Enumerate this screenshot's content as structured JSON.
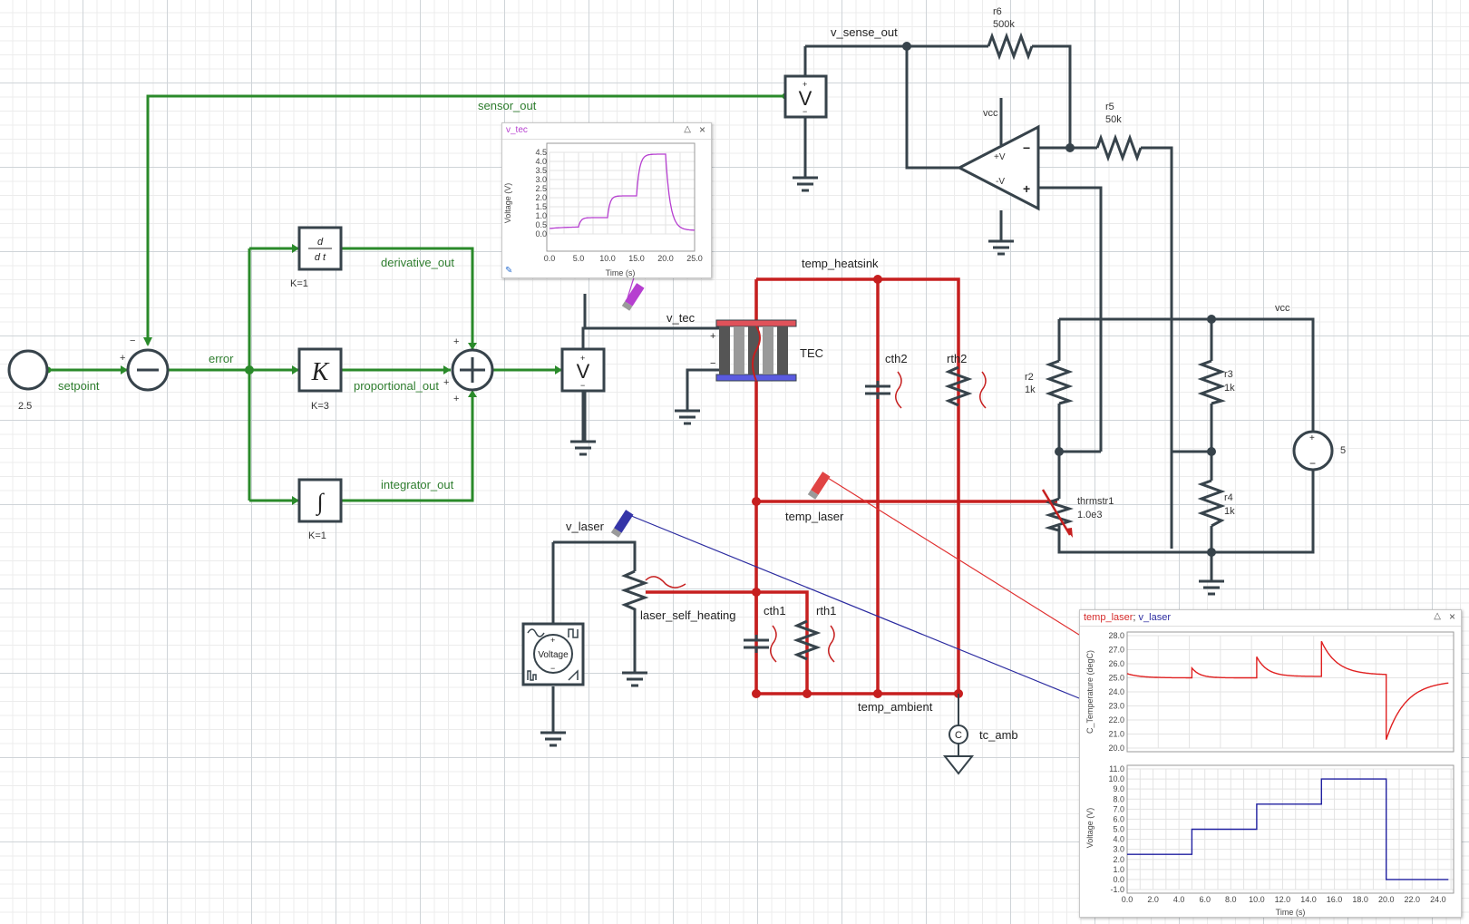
{
  "blocks": {
    "setpoint_value": "2.5",
    "setpoint_label": "setpoint",
    "error_label": "error",
    "sensor_out_label": "sensor_out",
    "derivative_label": "derivative_out",
    "proportional_label": "proportional_out",
    "integrator_label": "integrator_out",
    "deriv_gain": "K=1",
    "prop_gain": "K=3",
    "integ_gain": "K=1",
    "prop_symbol": "K",
    "deriv_symbol_top": "d",
    "deriv_symbol_bottom": "d t",
    "integ_symbol": "∫",
    "voltmeter_symbol": "V"
  },
  "signs": {
    "plus": "+",
    "minus": "−"
  },
  "circuit": {
    "v_sense_out": "v_sense_out",
    "r6_name": "r6",
    "r6_value": "500k",
    "r5_name": "r5",
    "r5_value": "50k",
    "vcc_opamp": "vcc",
    "opamp_pos": "+V",
    "opamp_neg": "-V",
    "vcc": "vcc",
    "r2_name": "r2",
    "r2_value": "1k",
    "r3_name": "r3",
    "r3_value": "1k",
    "r4_name": "r4",
    "r4_value": "1k",
    "thermistor_name": "thrmstr1",
    "thermistor_value": "1.0e3",
    "source_value": "5",
    "v_tec": "v_tec",
    "tec_label": "TEC",
    "v_laser": "v_laser",
    "voltage_source_label": "Voltage",
    "laser_self_heating": "laser_self_heating"
  },
  "thermal": {
    "temp_heatsink": "temp_heatsink",
    "temp_laser": "temp_laser",
    "temp_ambient": "temp_ambient",
    "cth1": "cth1",
    "rth1": "rth1",
    "cth2": "cth2",
    "rth2": "rth2",
    "tc_amb": "tc_amb",
    "tc_symbol": "C"
  },
  "scopes": {
    "vtec": {
      "title": "v_tec",
      "ylabel": "Voltage (V)",
      "xlabel": "Time (s)",
      "yticks": [
        "4.5",
        "4.0",
        "3.5",
        "3.0",
        "2.5",
        "2.0",
        "1.5",
        "1.0",
        "0.5",
        "0.0"
      ],
      "xticks": [
        "0.0",
        "5.0",
        "10.0",
        "15.0",
        "20.0",
        "25.0"
      ]
    },
    "laser": {
      "title_a": "temp_laser",
      "title_sep": ";",
      "title_b": "v_laser",
      "top_ylabel": "C_Temperature (degC)",
      "top_yticks": [
        "28.0",
        "27.0",
        "26.0",
        "25.0",
        "24.0",
        "23.0",
        "22.0",
        "21.0",
        "20.0"
      ],
      "bottom_ylabel": "Voltage (V)",
      "bottom_yticks": [
        "11.0",
        "10.0",
        "9.0",
        "8.0",
        "7.0",
        "6.0",
        "5.0",
        "4.0",
        "3.0",
        "2.0",
        "1.0",
        "0.0",
        "-1.0"
      ],
      "xlabel": "Time (s)",
      "xticks": [
        "0.0",
        "2.0",
        "4.0",
        "6.0",
        "8.0",
        "10.0",
        "12.0",
        "14.0",
        "16.0",
        "18.0",
        "20.0",
        "22.0",
        "24.0"
      ]
    }
  },
  "colors": {
    "signal": "#2a8a2a",
    "wire": "#37434b",
    "thermal": "#c61f1f",
    "probe_vtec": "#b63fd0",
    "probe_laser_temp": "#e04444",
    "probe_laser_v": "#3535a8",
    "tec_hot": "#e0525a",
    "tec_cold": "#5a5ae0"
  }
}
